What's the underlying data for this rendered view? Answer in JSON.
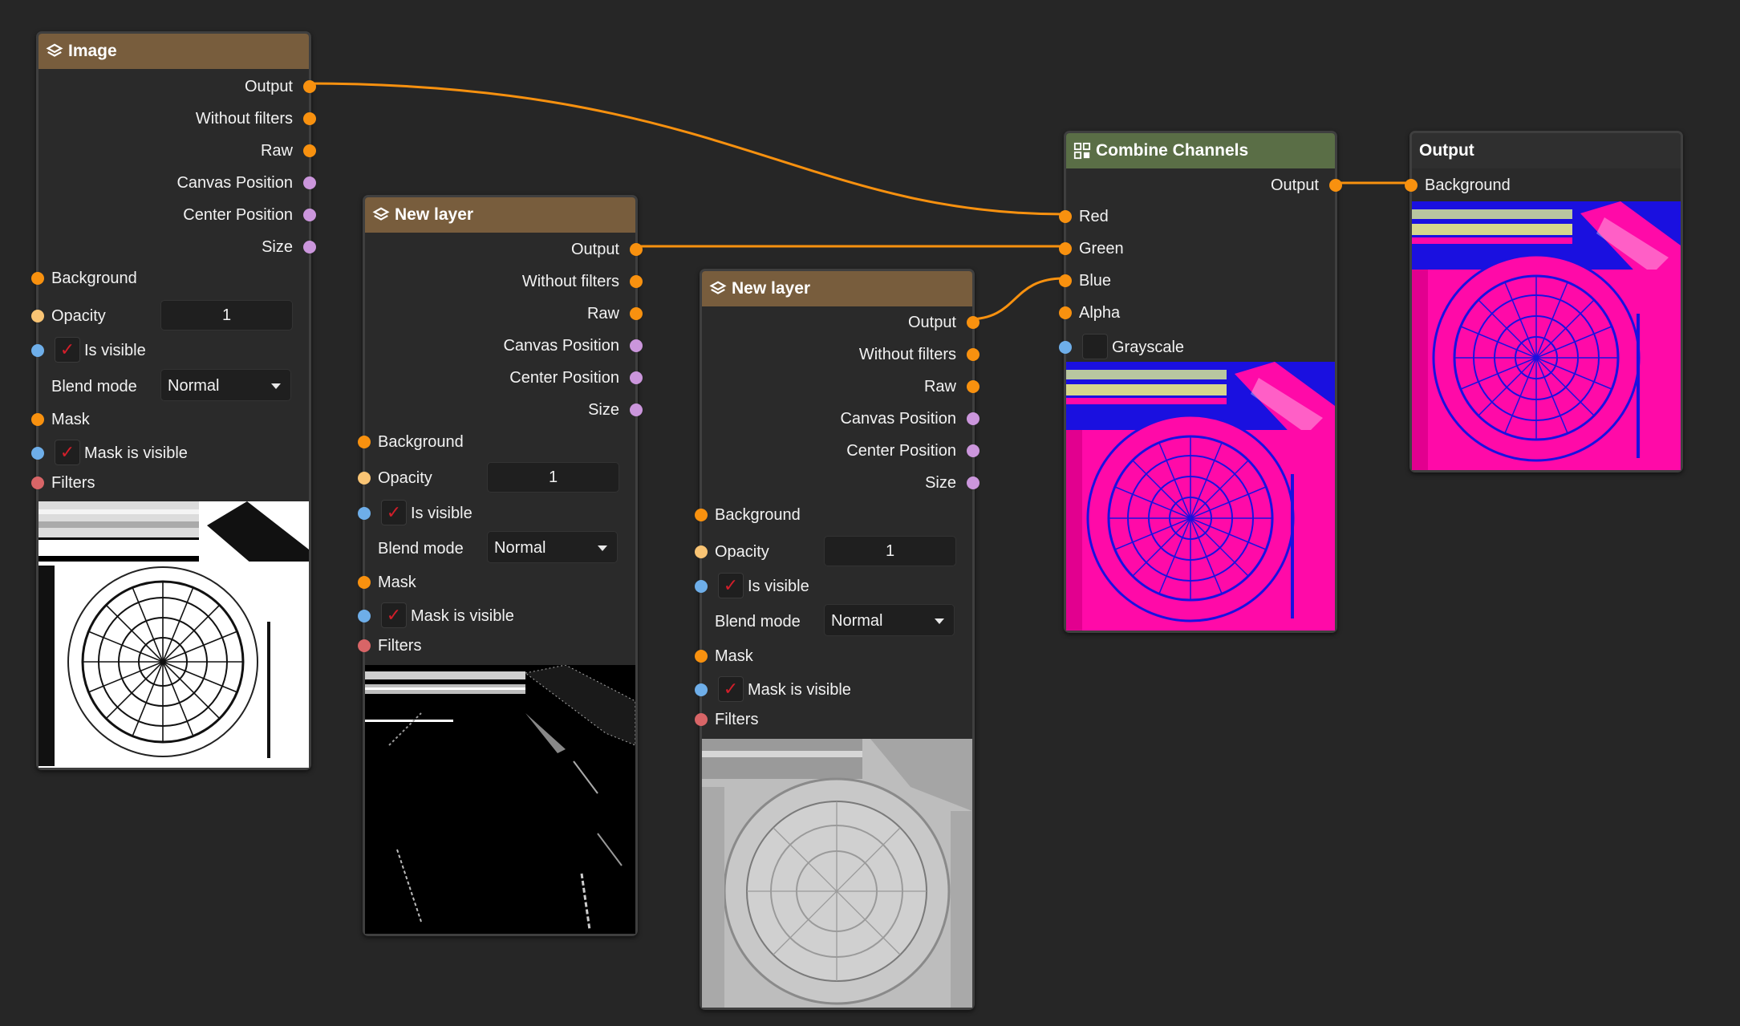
{
  "colors": {
    "canvas": "#262626",
    "image_header": "#785d3d",
    "combine_header": "#5a6e46",
    "wire": "#f8910f",
    "socket_image": "#f8910f",
    "socket_vector": "#cb96dc",
    "socket_float": "#f9c474",
    "socket_bool": "#6eaee9",
    "socket_filter": "#d86567",
    "preview_magenta": "#ff0aa8",
    "preview_blue": "#1a10e0"
  },
  "nodes": {
    "image": {
      "title": "Image",
      "icon": "layers-icon",
      "outputs": [
        "Output",
        "Without filters",
        "Raw",
        "Canvas Position",
        "Center Position",
        "Size"
      ],
      "background_label": "Background",
      "opacity_label": "Opacity",
      "opacity_value": "1",
      "is_visible_label": "Is visible",
      "blend_mode_label": "Blend mode",
      "blend_mode_value": "Normal",
      "mask_label": "Mask",
      "mask_visible_label": "Mask is visible",
      "filters_label": "Filters",
      "check_mark": "✓"
    },
    "layer1": {
      "title": "New layer",
      "icon": "layers-icon",
      "outputs": [
        "Output",
        "Without filters",
        "Raw",
        "Canvas Position",
        "Center Position",
        "Size"
      ],
      "background_label": "Background",
      "opacity_label": "Opacity",
      "opacity_value": "1",
      "is_visible_label": "Is visible",
      "blend_mode_label": "Blend mode",
      "blend_mode_value": "Normal",
      "mask_label": "Mask",
      "mask_visible_label": "Mask is visible",
      "filters_label": "Filters",
      "check_mark": "✓"
    },
    "layer2": {
      "title": "New layer",
      "icon": "layers-icon",
      "outputs": [
        "Output",
        "Without filters",
        "Raw",
        "Canvas Position",
        "Center Position",
        "Size"
      ],
      "background_label": "Background",
      "opacity_label": "Opacity",
      "opacity_value": "1",
      "is_visible_label": "Is visible",
      "blend_mode_label": "Blend mode",
      "blend_mode_value": "Normal",
      "mask_label": "Mask",
      "mask_visible_label": "Mask is visible",
      "filters_label": "Filters",
      "check_mark": "✓"
    },
    "combine": {
      "title": "Combine Channels",
      "icon": "channels-icon",
      "output_label": "Output",
      "inputs": [
        "Red",
        "Green",
        "Blue",
        "Alpha"
      ],
      "grayscale_label": "Grayscale"
    },
    "output": {
      "title": "Output",
      "background_label": "Background"
    }
  }
}
